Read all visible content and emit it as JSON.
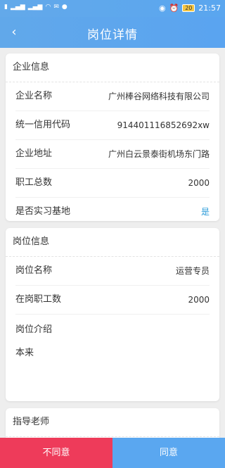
{
  "status": {
    "left_icons": [
      "sim-icon",
      "signal-icon",
      "wifi-icon",
      "message-icon",
      "chat-icon"
    ],
    "battery": "20",
    "time": "21:57"
  },
  "nav": {
    "back_icon": "‹",
    "title": "岗位详情"
  },
  "company": {
    "header": "企业信息",
    "rows": [
      {
        "label": "企业名称",
        "value": "广州棒谷网络科技有限公司"
      },
      {
        "label": "统一信用代码",
        "value": "914401116852692xw"
      },
      {
        "label": "企业地址",
        "value": "广州白云景泰街机场东门路"
      },
      {
        "label": "职工总数",
        "value": "2000"
      },
      {
        "label": "是否实习基地",
        "value": "是"
      }
    ]
  },
  "position": {
    "header": "岗位信息",
    "rows": [
      {
        "label": "岗位名称",
        "value": "运营专员"
      },
      {
        "label": "在岗职工数",
        "value": "2000"
      }
    ],
    "intro_label": "岗位介绍",
    "intro_text": "本来"
  },
  "teacher": {
    "header": "指导老师"
  },
  "footer": {
    "reject": "不同意",
    "agree": "同意"
  },
  "colors": {
    "primary": "#5aa7f0",
    "reject": "#ee3b5a",
    "accent": "#2a9bd9"
  }
}
